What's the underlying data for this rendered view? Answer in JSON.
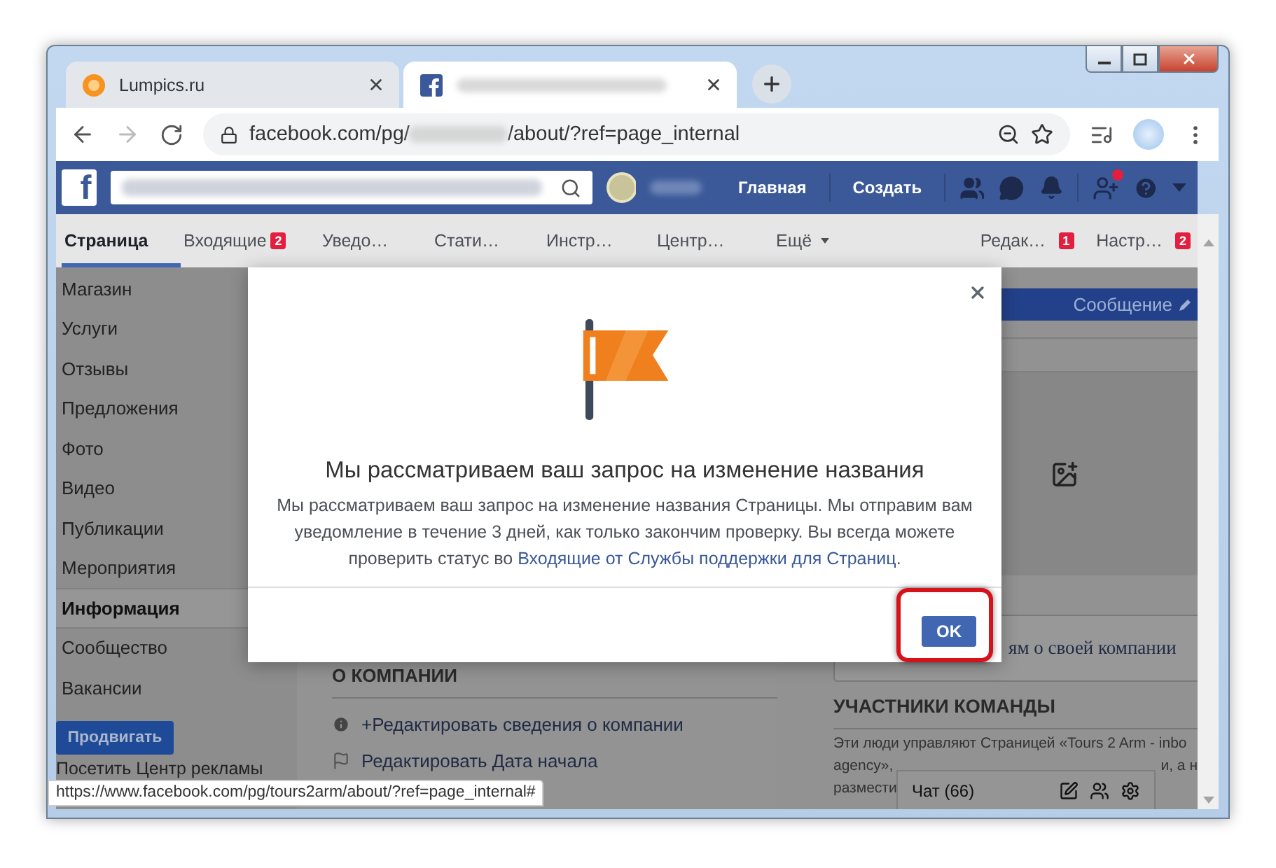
{
  "browser": {
    "tabs": [
      {
        "kind": "lumpics",
        "title": "Lumpics.ru",
        "selected": false
      },
      {
        "kind": "facebook",
        "selected": true
      }
    ],
    "address": {
      "prefix": "facebook.com/pg/",
      "suffix": "/about/?ref=page_internal"
    }
  },
  "facebook_bar": {
    "logo": "f",
    "links": [
      "Главная",
      "Создать"
    ],
    "requests_dot": true
  },
  "page_nav": {
    "items": [
      {
        "label": "Страница",
        "selected": true
      },
      {
        "label": "Входящие",
        "badge": "2",
        "selected": false
      },
      {
        "label": "Уведо…",
        "selected": false
      },
      {
        "label": "Стати…",
        "selected": false
      },
      {
        "label": "Инстр…",
        "selected": false
      },
      {
        "label": "Центр…",
        "selected": false
      },
      {
        "label": "Ещё",
        "dropdown": true,
        "selected": false
      }
    ],
    "right_items": [
      {
        "label": "Редак…",
        "badge": "1",
        "selected": false
      },
      {
        "label": "Настр…",
        "badge": "2",
        "selected": false
      }
    ]
  },
  "sidebar": {
    "items": [
      {
        "label": "Магазин",
        "selected": false
      },
      {
        "label": "Услуги",
        "selected": false
      },
      {
        "label": "Отзывы",
        "selected": false
      },
      {
        "label": "Предложения",
        "selected": false
      },
      {
        "label": "Фото",
        "selected": false
      },
      {
        "label": "Видео",
        "selected": false
      },
      {
        "label": "Публикации",
        "selected": false
      },
      {
        "label": "Мероприятия",
        "selected": false
      },
      {
        "label": "Информация",
        "selected": true
      },
      {
        "label": "Сообщество",
        "selected": false
      },
      {
        "label": "Вакансии",
        "selected": false
      }
    ],
    "promote_button": "Продвигать",
    "ads_link": "Посетить Центр рекламы"
  },
  "cover": {
    "message_button": "Сообщение"
  },
  "about": {
    "heading": "О КОМПАНИИ",
    "items": [
      {
        "kind": "info",
        "text": "+Редактировать сведения о компании"
      },
      {
        "kind": "flag",
        "text": "Редактировать Дата начала"
      }
    ]
  },
  "company_card": {
    "text": "ям о своей компании"
  },
  "team": {
    "heading": "УЧАСТНИКИ КОМАНДЫ",
    "lines": [
      [
        "Эти люди управляют Страницей «Tours 2 Arm - inbo"
      ],
      [
        "agency»,",
        "и, а н"
      ],
      [
        "размести"
      ]
    ]
  },
  "chat": {
    "label": "Чат (66)"
  },
  "modal": {
    "title": "Мы рассматриваем ваш запрос на изменение названия",
    "body": "Мы рассматриваем ваш запрос на изменение названия Страницы. Мы отправим вам уведомление в течение 3 дней, как только закончим проверку. Вы всегда можете проверить статус во ",
    "link": "Входящие от Службы поддержки для Страниц",
    "body_end": ".",
    "ok_button": "OK",
    "ok_highlighted": true
  },
  "status_url": "https://www.facebook.com/pg/tours2arm/about/?ref=page_internal#"
}
